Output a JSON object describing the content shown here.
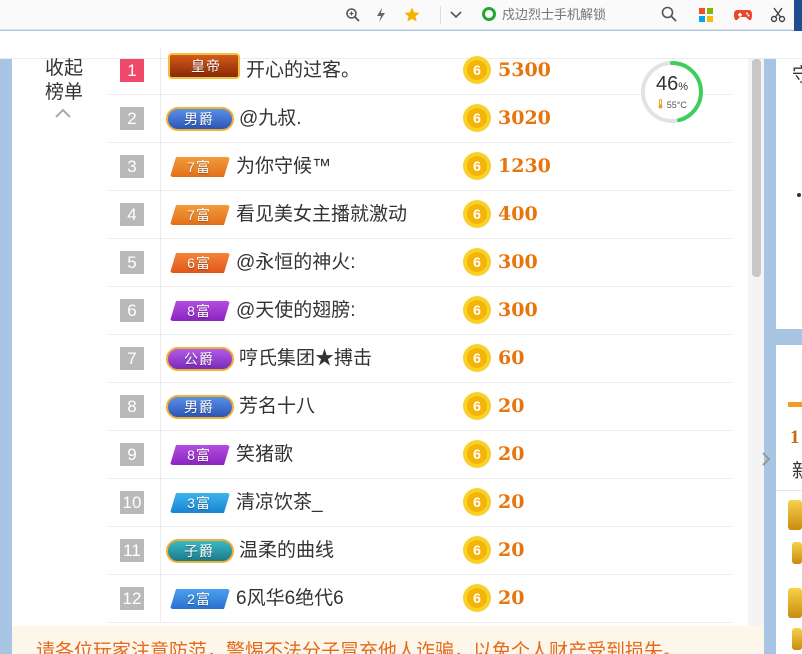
{
  "toolbar": {
    "icons": [
      "zoom-icon",
      "lightning-icon",
      "star-icon",
      "chevron-down-icon",
      "search-icon",
      "apps-icon",
      "gamepad-icon",
      "scissors-icon"
    ],
    "search_placeholder": "戍边烈士手机解锁",
    "accent": "#21a838"
  },
  "sidebar": {
    "collapse_line1": "收起",
    "collapse_line2": "榜单"
  },
  "gauge": {
    "percent": "46",
    "percent_unit": "%",
    "temperature": "55°C",
    "level": 0.46,
    "color": "#3ccf5a"
  },
  "ranking": [
    {
      "rank": "1",
      "badge": "皇帝",
      "badge_type": "emperor",
      "name": "开心的过客。",
      "score": "5300"
    },
    {
      "rank": "2",
      "badge": "男爵",
      "badge_type": "baron",
      "name": "@九叔.",
      "score": "3020"
    },
    {
      "rank": "3",
      "badge": "7富",
      "badge_type": "rich7",
      "name": "为你守候™",
      "score": "1230"
    },
    {
      "rank": "4",
      "badge": "7富",
      "badge_type": "rich7",
      "name": "看见美女主播就激动",
      "score": "400"
    },
    {
      "rank": "5",
      "badge": "6富",
      "badge_type": "rich6",
      "name": "@永恒的神火:",
      "score": "300"
    },
    {
      "rank": "6",
      "badge": "8富",
      "badge_type": "rich8",
      "name": "@天使的翅膀:",
      "score": "300"
    },
    {
      "rank": "7",
      "badge": "公爵",
      "badge_type": "duke",
      "name": "哼氏集团★搏击",
      "score": "60"
    },
    {
      "rank": "8",
      "badge": "男爵",
      "badge_type": "baron",
      "name": "芳名十八",
      "score": "20"
    },
    {
      "rank": "9",
      "badge": "8富",
      "badge_type": "rich8",
      "name": "笑猪歌",
      "score": "20"
    },
    {
      "rank": "10",
      "badge": "3富",
      "badge_type": "rich3",
      "name": "清凉饮茶_",
      "score": "20"
    },
    {
      "rank": "11",
      "badge": "子爵",
      "badge_type": "viscount",
      "name": "温柔的曲线",
      "score": "20"
    },
    {
      "rank": "12",
      "badge": "2富",
      "badge_type": "rich2",
      "name": "6风华6绝代6",
      "score": "20"
    }
  ],
  "coin_glyph": "6",
  "notice": "请各位玩家注意防范，警惕不法分子冒充他人诈骗，以免个人财产受到损失。",
  "side": {
    "text_top": "守",
    "text_num": "1",
    "text_new": "新"
  },
  "colors": {
    "score": "#e8740c",
    "rank_first": "#f04a6a",
    "rank_default": "#b9b9b9",
    "notice": "#e46a1c"
  }
}
